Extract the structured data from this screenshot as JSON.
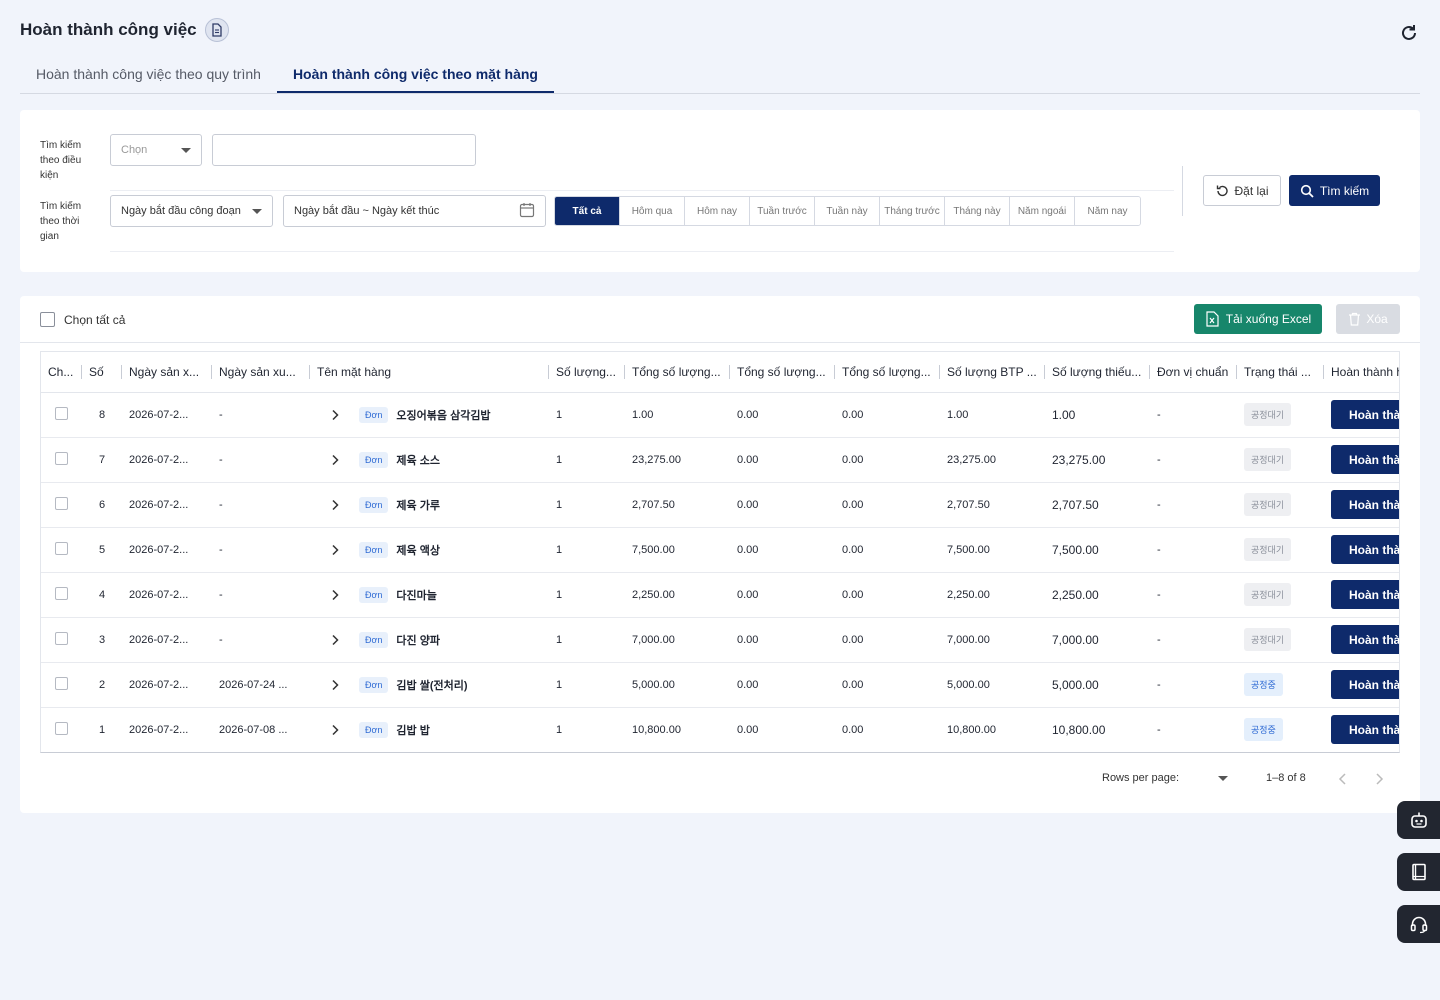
{
  "header": {
    "title": "Hoàn thành công việc"
  },
  "tabs": [
    {
      "label": "Hoàn thành công việc theo quy trình",
      "active": false
    },
    {
      "label": "Hoàn thành công việc theo mặt hàng",
      "active": true
    }
  ],
  "filter": {
    "condition_label": "Tìm kiếm theo điều kiện",
    "condition_select": "Chọn",
    "time_label": "Tìm kiếm theo thời gian",
    "time_select": "Ngày bắt đầu công đoạn",
    "date_range_placeholder": "Ngày bắt đầu ~ Ngày kết thúc",
    "periods": [
      "Tất cả",
      "Hôm qua",
      "Hôm nay",
      "Tuần trước",
      "Tuần này",
      "Tháng trước",
      "Tháng này",
      "Năm ngoái",
      "Năm nay"
    ],
    "reset_label": "Đặt lại",
    "search_label": "Tìm kiếm"
  },
  "toolbar": {
    "select_all_label": "Chọn tất cả",
    "excel_label": "Tải xuống Excel",
    "delete_label": "Xóa"
  },
  "table": {
    "columns": [
      "Ch...",
      "Số",
      "Ngày sản x...",
      "Ngày sản xu...",
      "Tên mặt hàng",
      "Số lượng...",
      "Tổng số lượng...",
      "Tổng số lượng...",
      "Tổng số lượng...",
      "Số lượng BTP ...",
      "Số lượng thiếu...",
      "Đơn vị chuẩn",
      "Trạng thái ...",
      "Hoàn thành h"
    ],
    "badge": "Đơn",
    "complete_label": "Hoàn thành",
    "rows": [
      {
        "no": "8",
        "d1": "2026-07-2...",
        "d2": "-",
        "name": "오징어볶음 삼각김밥",
        "qty": "1",
        "t1": "1.00",
        "t2": "0.00",
        "t3": "0.00",
        "btp": "1.00",
        "short": "1.00",
        "unit": "-",
        "status": "공정대기",
        "status_type": "wait"
      },
      {
        "no": "7",
        "d1": "2026-07-2...",
        "d2": "-",
        "name": "제육 소스",
        "qty": "1",
        "t1": "23,275.00",
        "t2": "0.00",
        "t3": "0.00",
        "btp": "23,275.00",
        "short": "23,275.00",
        "unit": "-",
        "status": "공정대기",
        "status_type": "wait"
      },
      {
        "no": "6",
        "d1": "2026-07-2...",
        "d2": "-",
        "name": "제육 가루",
        "qty": "1",
        "t1": "2,707.50",
        "t2": "0.00",
        "t3": "0.00",
        "btp": "2,707.50",
        "short": "2,707.50",
        "unit": "-",
        "status": "공정대기",
        "status_type": "wait"
      },
      {
        "no": "5",
        "d1": "2026-07-2...",
        "d2": "-",
        "name": "제육 액상",
        "qty": "1",
        "t1": "7,500.00",
        "t2": "0.00",
        "t3": "0.00",
        "btp": "7,500.00",
        "short": "7,500.00",
        "unit": "-",
        "status": "공정대기",
        "status_type": "wait"
      },
      {
        "no": "4",
        "d1": "2026-07-2...",
        "d2": "-",
        "name": "다진마늘",
        "qty": "1",
        "t1": "2,250.00",
        "t2": "0.00",
        "t3": "0.00",
        "btp": "2,250.00",
        "short": "2,250.00",
        "unit": "-",
        "status": "공정대기",
        "status_type": "wait"
      },
      {
        "no": "3",
        "d1": "2026-07-2...",
        "d2": "-",
        "name": "다진 양파",
        "qty": "1",
        "t1": "7,000.00",
        "t2": "0.00",
        "t3": "0.00",
        "btp": "7,000.00",
        "short": "7,000.00",
        "unit": "-",
        "status": "공정대기",
        "status_type": "wait"
      },
      {
        "no": "2",
        "d1": "2026-07-2...",
        "d2": "2026-07-24 ...",
        "name": "김밥 쌀(전처리)",
        "qty": "1",
        "t1": "5,000.00",
        "t2": "0.00",
        "t3": "0.00",
        "btp": "5,000.00",
        "short": "5,000.00",
        "unit": "-",
        "status": "공정중",
        "status_type": "proc"
      },
      {
        "no": "1",
        "d1": "2026-07-2...",
        "d2": "2026-07-08 ...",
        "name": "김밥 밥",
        "qty": "1",
        "t1": "10,800.00",
        "t2": "0.00",
        "t3": "0.00",
        "btp": "10,800.00",
        "short": "10,800.00",
        "unit": "-",
        "status": "공정중",
        "status_type": "proc"
      }
    ]
  },
  "pagination": {
    "rows_per_page_label": "Rows per page:",
    "range": "1–8 of 8"
  },
  "colors": {
    "primary": "#0e2a6b",
    "excel": "#17866b",
    "background": "#f1f4fb"
  }
}
